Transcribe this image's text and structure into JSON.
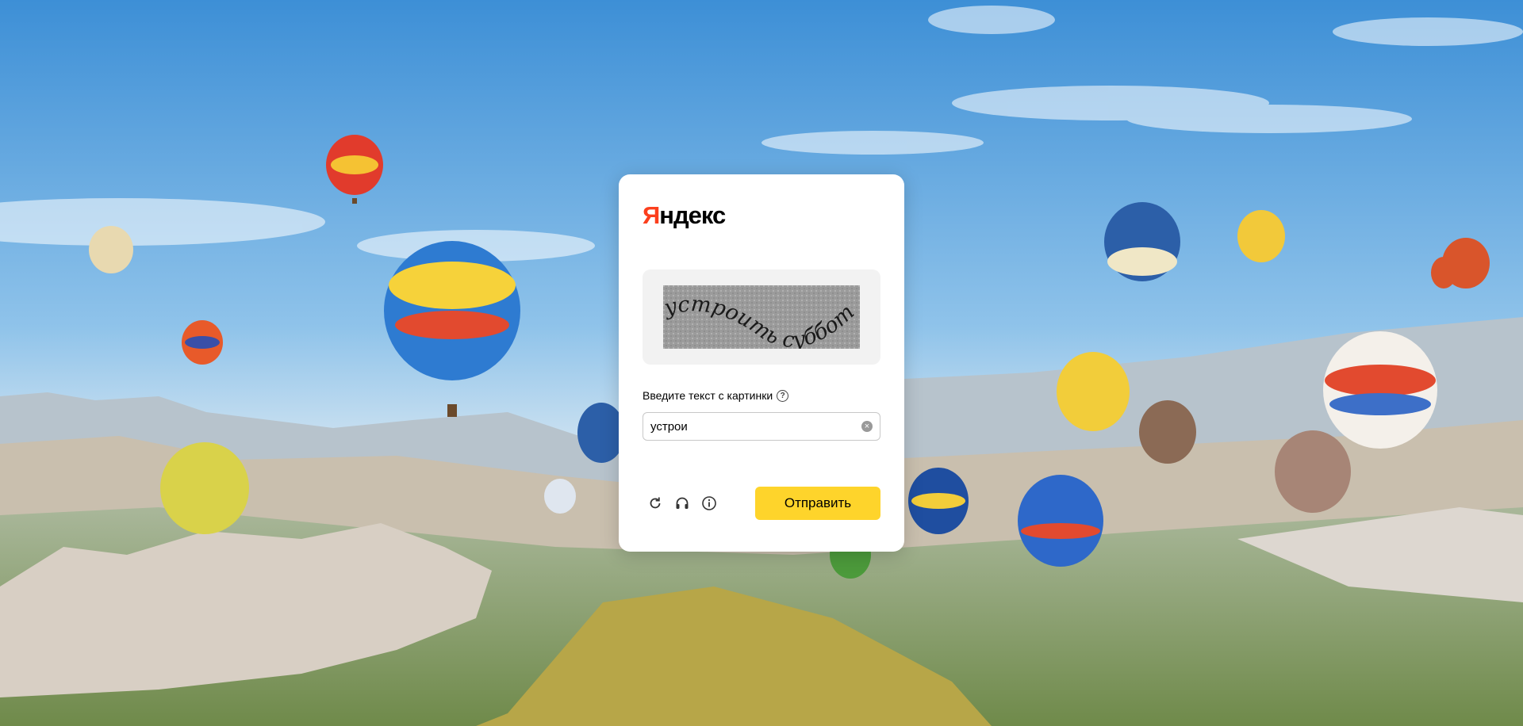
{
  "background": {
    "description_icon": "hot-air-balloons-landscape"
  },
  "card": {
    "logo": {
      "first_letter": "Я",
      "rest": "ндекс"
    },
    "captcha": {
      "text": "устроить субботу"
    },
    "label": "Введите текст с картинки",
    "input": {
      "value": "устрои"
    },
    "buttons": {
      "refresh_icon": "refresh-icon",
      "audio_icon": "headphones-icon",
      "info_icon": "info-icon",
      "submit_label": "Отправить"
    }
  },
  "colors": {
    "brand_red": "#fc3f1d",
    "submit_yellow": "#fed42b"
  }
}
